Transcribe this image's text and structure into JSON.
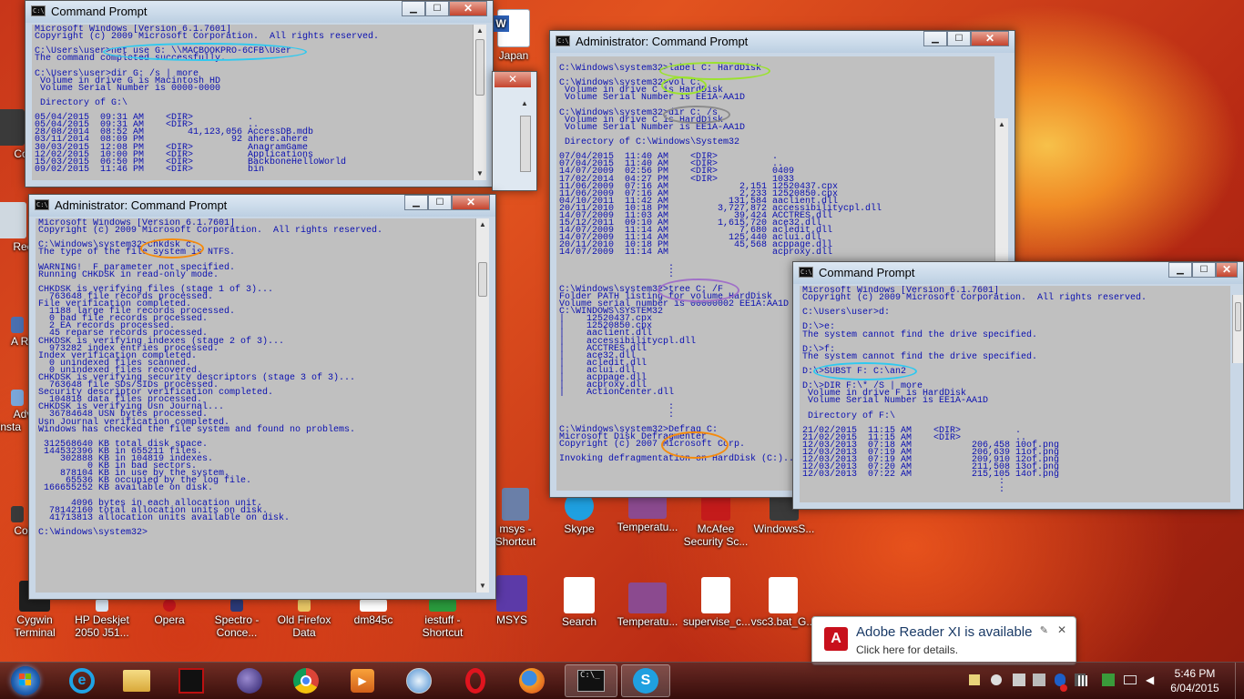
{
  "windows": {
    "w1": {
      "title": "Command Prompt",
      "lines": [
        "Microsoft Windows [Version 6.1.7601]",
        "Copyright (c) 2009 Microsoft Corporation.  All rights reserved.",
        "",
        "C:\\Users\\user>net use G: \\\\MACBOOKPRO-6CFB\\User",
        "The command completed successfully.",
        "",
        "C:\\Users\\user>dir G: /s | more",
        " Volume in drive G is Macintosh HD",
        " Volume Serial Number is 0000-0000",
        "",
        " Directory of G:\\",
        "",
        "05/04/2015  09:31 AM    <DIR>          .",
        "05/04/2015  09:31 AM    <DIR>          ..",
        "28/08/2014  08:52 AM        41,123,056 AccessDB.mdb",
        "03/11/2014  08:09 PM                92 ahere.ahere",
        "30/03/2015  12:08 PM    <DIR>          AnagramGame",
        "12/02/2015  10:00 PM    <DIR>          Applications",
        "15/03/2015  06:50 PM    <DIR>          BackboneHelloWorld",
        "09/02/2015  11:46 PM    <DIR>          bin"
      ]
    },
    "w2": {
      "title": "Administrator: Command Prompt",
      "lines": [
        "Microsoft Windows [Version 6.1.7601]",
        "Copyright (c) 2009 Microsoft Corporation.  All rights reserved.",
        "",
        "C:\\Windows\\system32>chkdsk c:",
        "The type of the file system is NTFS.",
        "",
        "WARNING!  F parameter not specified.",
        "Running CHKDSK in read-only mode.",
        "",
        "CHKDSK is verifying files (stage 1 of 3)...",
        "  763648 file records processed.",
        "File verification completed.",
        "  1188 large file records processed.",
        "  0 bad file records processed.",
        "  2 EA records processed.",
        "  45 reparse records processed.",
        "CHKDSK is verifying indexes (stage 2 of 3)...",
        "  973282 index entries processed.",
        "Index verification completed.",
        "  0 unindexed files scanned.",
        "  0 unindexed files recovered.",
        "CHKDSK is verifying security descriptors (stage 3 of 3)...",
        "  763648 file SDs/SIDs processed.",
        "Security descriptor verification completed.",
        "  104818 data files processed.",
        "CHKDSK is verifying Usn Journal...",
        "  36784648 USN bytes processed.",
        "Usn Journal verification completed.",
        "Windows has checked the file system and found no problems.",
        "",
        " 312568640 KB total disk space.",
        " 144532396 KB in 655211 files.",
        "    302888 KB in 104819 indexes.",
        "         0 KB in bad sectors.",
        "    878104 KB in use by the system.",
        "     65536 KB occupied by the log file.",
        " 166655252 KB available on disk.",
        "",
        "      4096 bytes in each allocation unit.",
        "  78142160 total allocation units on disk.",
        "  41713813 allocation units available on disk.",
        "",
        "C:\\Windows\\system32>"
      ]
    },
    "w3": {
      "title": "Administrator: Command Prompt",
      "lines": [
        "",
        "C:\\Windows\\system32>label C: HardDisk",
        "",
        "C:\\Windows\\system32>vol C:",
        " Volume in drive C is HardDisk",
        " Volume Serial Number is EE1A-AA1D",
        "",
        "C:\\Windows\\system32>dir C: /s",
        " Volume in drive C is HardDisk",
        " Volume Serial Number is EE1A-AA1D",
        "",
        " Directory of C:\\Windows\\System32",
        "",
        "07/04/2015  11:40 AM    <DIR>          .",
        "07/04/2015  11:40 AM    <DIR>          ..",
        "14/07/2009  02:56 PM    <DIR>          0409",
        "17/02/2014  04:27 PM    <DIR>          1033",
        "11/06/2009  07:16 AM             2,151 12520437.cpx",
        "11/06/2009  07:16 AM             2,233 12520850.cpx",
        "04/10/2011  11:42 AM           131,584 aaclient.dll",
        "20/11/2010  10:18 PM         3,727,872 accessibilitycpl.dll",
        "14/07/2009  11:03 AM            39,424 ACCTRES.dll",
        "15/12/2011  09:10 AM         1,615,720 ace32.dll",
        "14/07/2009  11:14 AM             7,680 acledit.dll",
        "14/07/2009  11:14 AM           125,440 aclui.dll",
        "20/11/2010  10:18 PM            45,568 acppage.dll",
        "14/07/2009  11:14 AM                   acproxy.dll",
        "",
        "                    :",
        "                    :",
        "",
        "C:\\Windows\\system32>tree C: /F",
        "Folder PATH listing for volume HardDisk",
        "Volume serial number is 00000002 EE1A:AA1D",
        "C:\\WINDOWS\\SYSTEM32",
        "|    12520437.cpx",
        "|    12520850.cpx",
        "|    aaclient.dll",
        "|    accessibilitycpl.dll",
        "|    ACCTRES.dll",
        "|    ace32.dll",
        "|    acledit.dll",
        "|    aclui.dll",
        "|    acppage.dll",
        "|    acproxy.dll",
        "|    ActionCenter.dll",
        "",
        "                    :",
        "                    :",
        "",
        "C:\\Windows\\system32>Defrag C:",
        "Microsoft Disk Defragmenter",
        "Copyright (c) 2007 Microsoft Corp.",
        "",
        "Invoking defragmentation on HardDisk (C:)..."
      ]
    },
    "w4": {
      "title": "Command Prompt",
      "lines": [
        "Microsoft Windows [Version 6.1.7601]",
        "Copyright (c) 2009 Microsoft Corporation.  All rights reserved.",
        "",
        "C:\\Users\\user>d:",
        "",
        "D:\\>e:",
        "The system cannot find the drive specified.",
        "",
        "D:\\>f:",
        "The system cannot find the drive specified.",
        "",
        "D:\\>SUBST F: C:\\an2",
        "",
        "D:\\>DIR F:\\* /S | more",
        " Volume in drive F is HardDisk",
        " Volume Serial Number is EE1A-AA1D",
        "",
        " Directory of F:\\",
        "",
        "21/02/2015  11:15 AM    <DIR>          .",
        "21/02/2015  11:15 AM    <DIR>          ..",
        "12/03/2013  07:18 AM           206,458 10of.png",
        "12/03/2013  07:19 AM           206,639 11of.png",
        "12/03/2013  07:19 AM           209,910 12of.png",
        "12/03/2013  07:20 AM           211,508 13of.png",
        "12/03/2013  07:22 AM           215,105 14of.png",
        "                                    :",
        "                                    :"
      ]
    }
  },
  "desktop_icons": [
    {
      "label": "Cygwin Terminal",
      "color": "#1f1f1f"
    },
    {
      "label": "HP Deskjet 2050 J51...",
      "color": "#d9e6f4"
    },
    {
      "label": "Opera",
      "color": "#c3161c"
    },
    {
      "label": "Spectro - Conce...",
      "color": "#2b3a78"
    },
    {
      "label": "Old Firefox Data",
      "color": "#e9c766"
    },
    {
      "label": "dm845c",
      "color": "#ffffff"
    },
    {
      "label": "iestuff - Shortcut",
      "color": "#2a9b3d"
    },
    {
      "label": "MSYS",
      "color": "#5c3aa8"
    },
    {
      "label": "Search",
      "color": "#ffffff"
    },
    {
      "label": "Temperatu...",
      "color": "#8b4a8f"
    },
    {
      "label": "supervise_c...",
      "color": "#ffffff"
    },
    {
      "label": "vsc3.bat_G...",
      "color": "#ffffff"
    },
    {
      "label": "msys - Shortcut",
      "color": "#6a7fa8"
    },
    {
      "label": "Skype",
      "color": "#1fa0e0"
    },
    {
      "label": "Temperatu...",
      "color": "#8b4a8f"
    },
    {
      "label": "McAfee Security Sc...",
      "color": "#c41b1b"
    },
    {
      "label": "WindowsS...",
      "color": "#3a3a3a"
    },
    {
      "label": "Japan",
      "color": "#2b5fb5"
    },
    {
      "label": "Co",
      "color": "#3a3a3a"
    },
    {
      "label": "Rec",
      "color": "#cfd8e0"
    },
    {
      "label": "A Re",
      "color": "#4a6fb0"
    },
    {
      "label": "Adv Insta",
      "color": "#7aa6d8"
    },
    {
      "label": "Cor",
      "color": "#3a3a3a"
    }
  ],
  "notification": {
    "title": "Adobe Reader XI is available",
    "subtitle": "Click here for details.",
    "close": "✕"
  },
  "taskbar": {
    "start": "Start",
    "pinned": [
      "internet-explorer",
      "file-explorer",
      "app-red",
      "eclipse",
      "chrome",
      "media-player",
      "safari",
      "opera",
      "firefox",
      "command-prompt",
      "skype"
    ],
    "clock_time": "5:46 PM",
    "clock_date": "6/04/2015"
  },
  "colors": {
    "console_bg": "#c0c0c0",
    "console_text": "#0a0fb0",
    "hl_cyan": "#2ec9f0",
    "hl_orange": "#f58a0c",
    "hl_green": "#9be22e",
    "hl_purple": "#a070c8"
  }
}
